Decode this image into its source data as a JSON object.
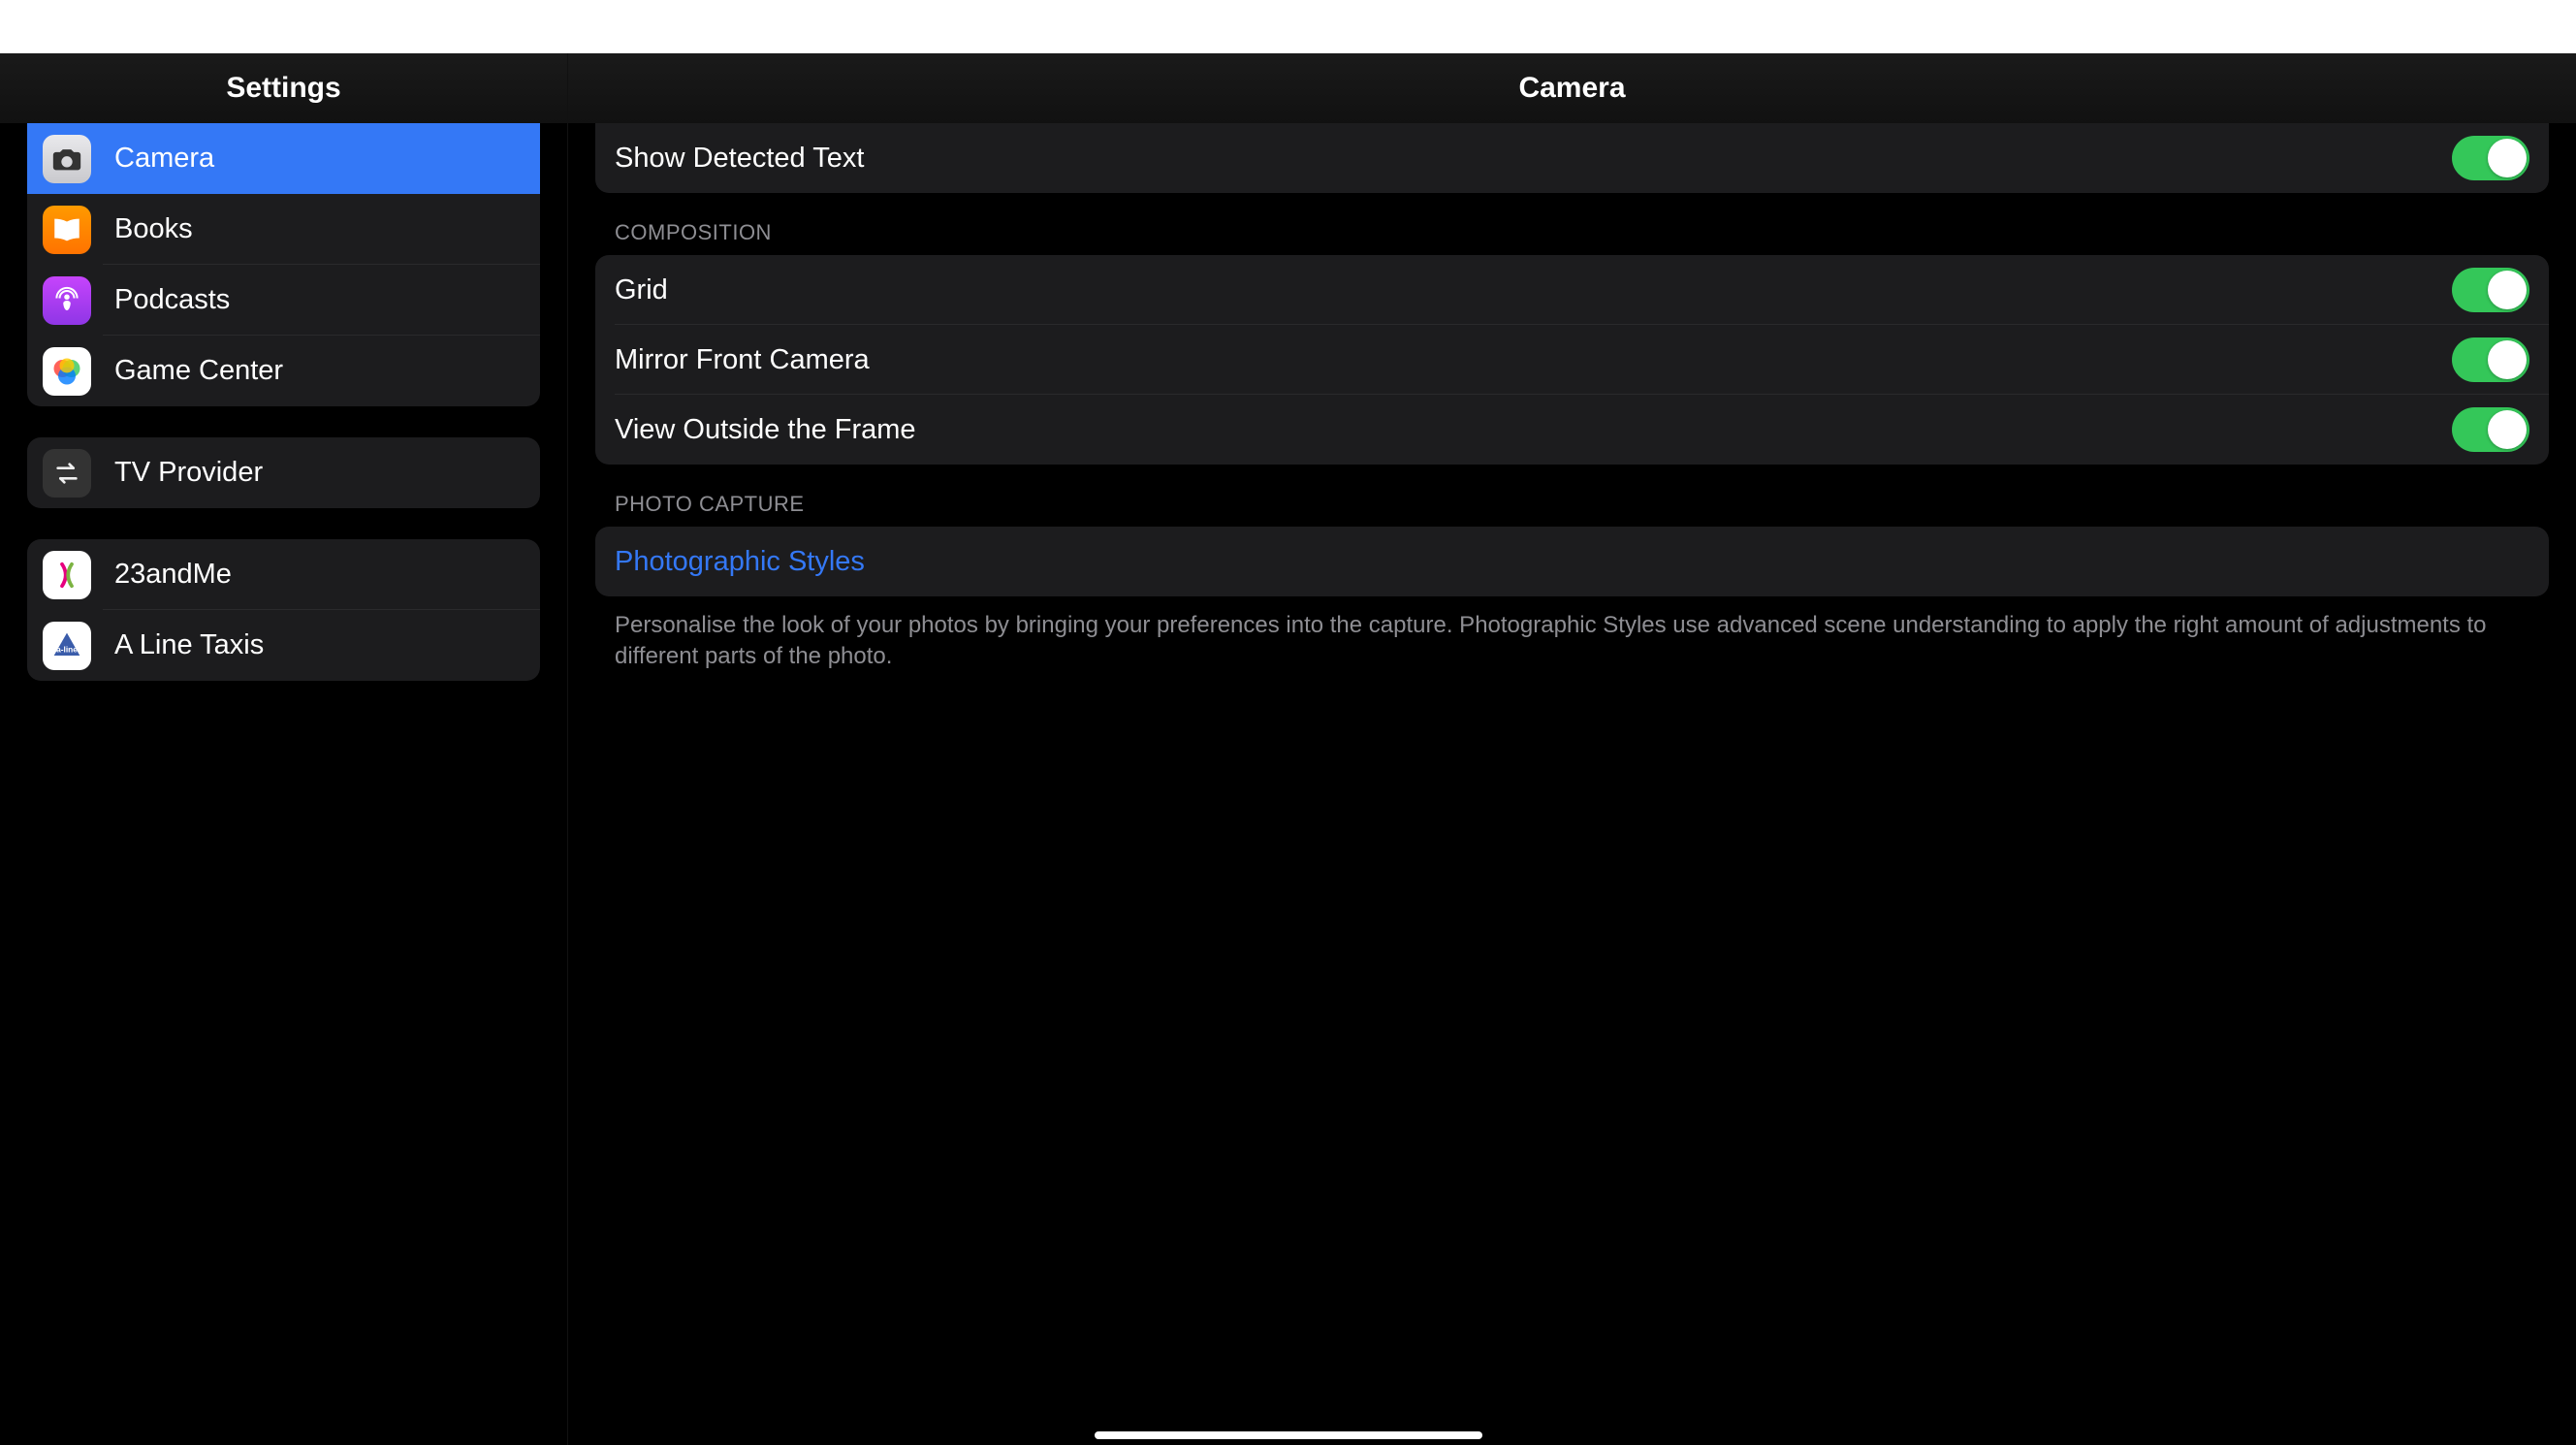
{
  "sidebar": {
    "title": "Settings",
    "group1": [
      {
        "label": "Camera",
        "icon": "camera-icon",
        "selected": true
      },
      {
        "label": "Books",
        "icon": "books-icon"
      },
      {
        "label": "Podcasts",
        "icon": "podcasts-icon"
      },
      {
        "label": "Game Center",
        "icon": "gamecenter-icon"
      }
    ],
    "group2": [
      {
        "label": "TV Provider",
        "icon": "tvprovider-icon"
      }
    ],
    "group3": [
      {
        "label": "23andMe",
        "icon": "23andme-icon"
      },
      {
        "label": "A Line Taxis",
        "icon": "alinetaxis-icon"
      }
    ]
  },
  "main": {
    "title": "Camera",
    "top_row": {
      "label": "Show Detected Text",
      "on": true
    },
    "composition": {
      "header": "COMPOSITION",
      "rows": [
        {
          "label": "Grid",
          "on": true
        },
        {
          "label": "Mirror Front Camera",
          "on": true
        },
        {
          "label": "View Outside the Frame",
          "on": true
        }
      ]
    },
    "photo_capture": {
      "header": "PHOTO CAPTURE",
      "link": "Photographic Styles",
      "footer": "Personalise the look of your photos by bringing your preferences into the capture. Photographic Styles use advanced scene understanding to apply the right amount of adjustments to different parts of the photo."
    }
  }
}
